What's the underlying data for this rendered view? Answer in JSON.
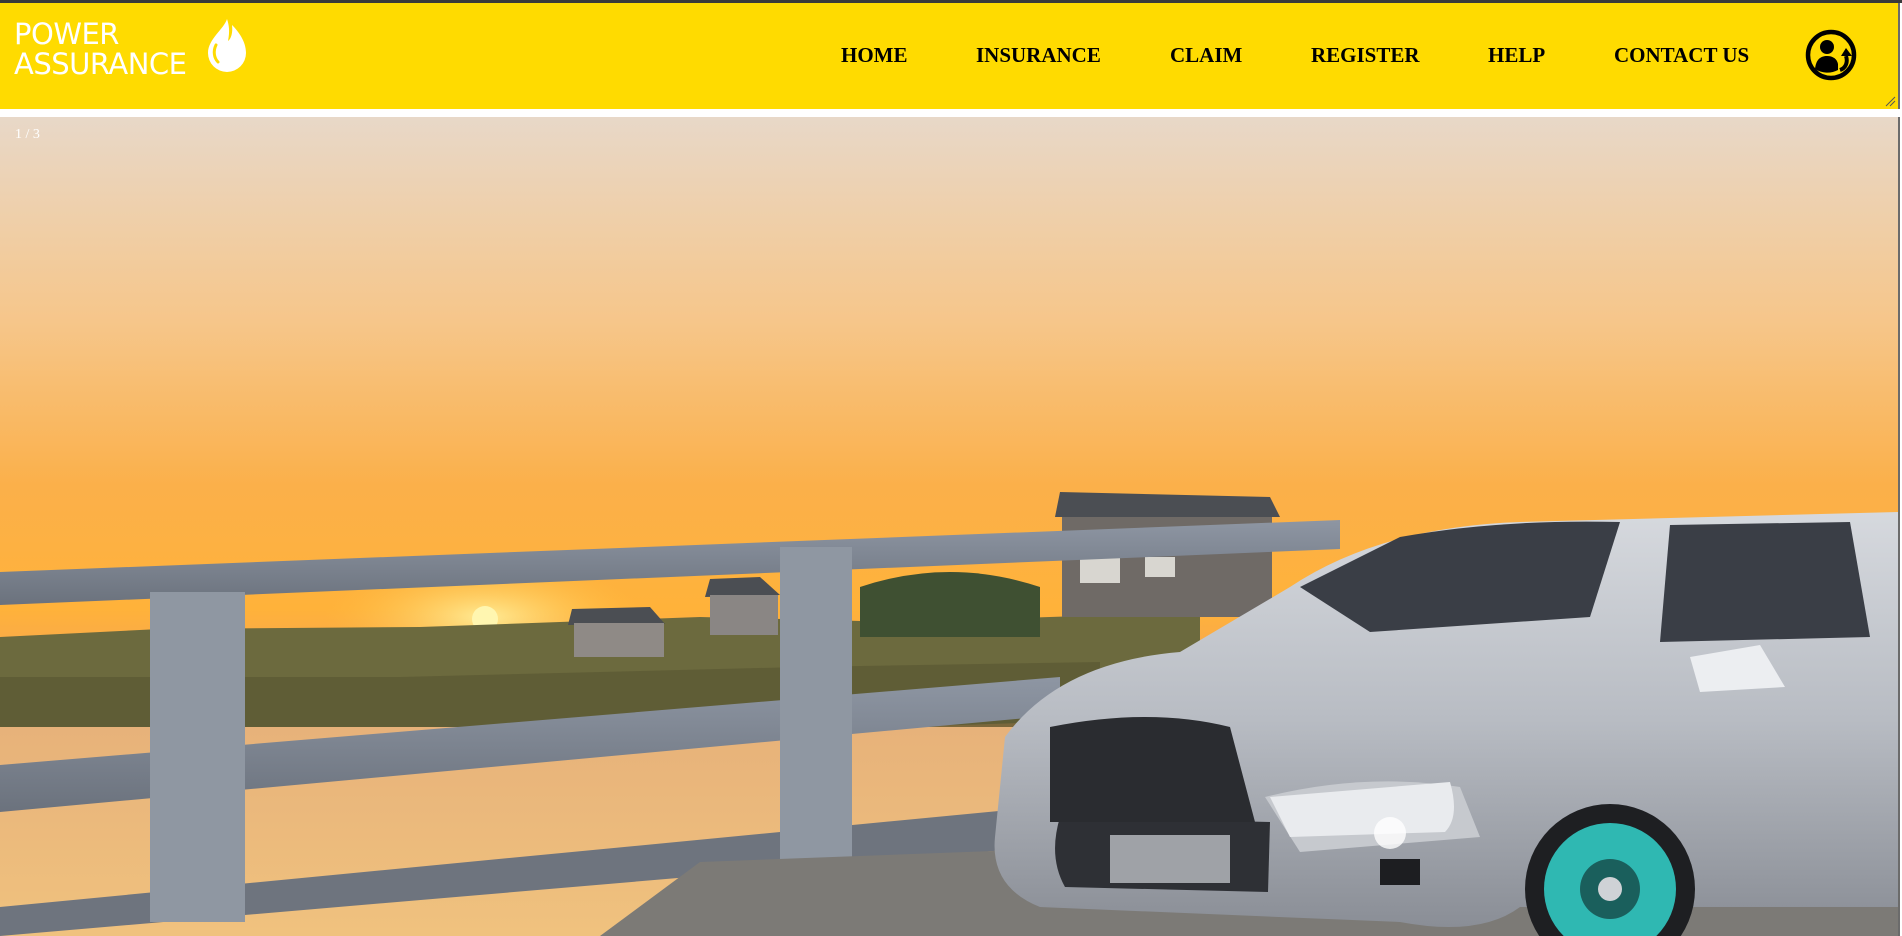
{
  "brand": {
    "line1": "POWER",
    "line2": "ASSURANCE",
    "logo_icon": "flame-drop-icon",
    "colors": {
      "header_bg": "#ffdb00",
      "logo_text": "#ffffff",
      "nav_text": "#000000"
    }
  },
  "nav": {
    "items": [
      {
        "label": "HOME"
      },
      {
        "label": "INSURANCE"
      },
      {
        "label": "CLAIM"
      },
      {
        "label": "REGISTER"
      },
      {
        "label": "HELP"
      },
      {
        "label": "CONTACT US"
      }
    ],
    "account_icon": "user-refresh-icon"
  },
  "slideshow": {
    "counter": "1 / 3",
    "current_index": 1,
    "total": 3,
    "image_subject": "silver-sedan-on-wooden-bridge-at-sunset"
  }
}
